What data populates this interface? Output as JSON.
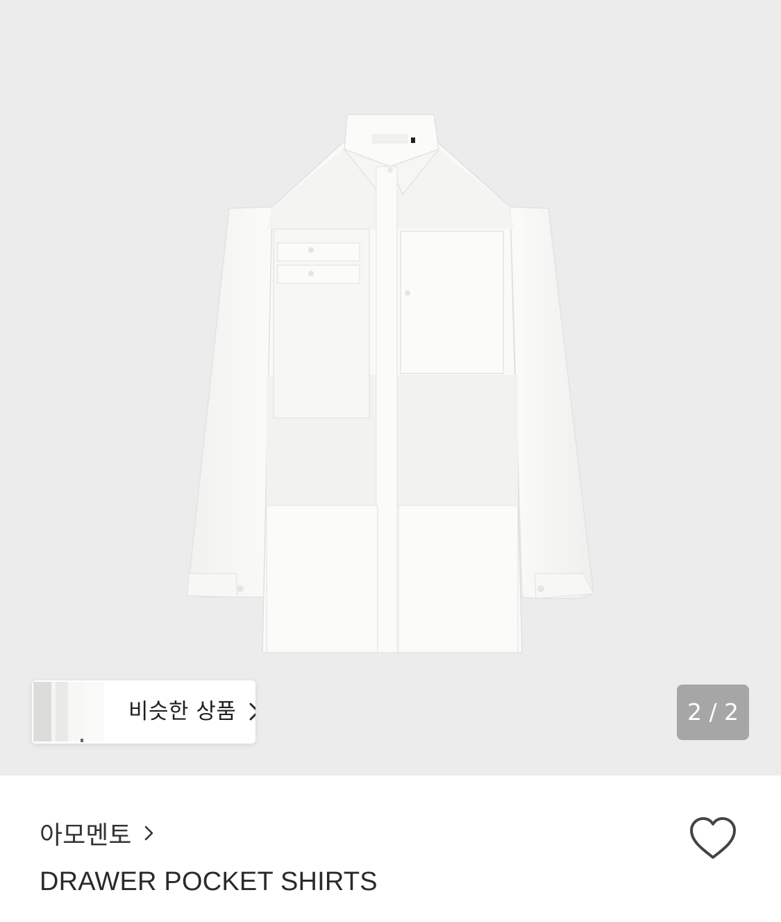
{
  "gallery": {
    "image_alt": "white shirt",
    "counter": "2 / 2",
    "similar_label": "비슷한 상품",
    "background": "#ececed"
  },
  "product": {
    "brand": "아모멘토",
    "title": "DRAWER POCKET SHIRTS"
  },
  "icons": {
    "similar_chevron": "chevron-right-icon",
    "brand_chevron": "chevron-right-icon",
    "wishlist": "heart-outline-icon"
  },
  "colors": {
    "text_primary": "#2a2a2a",
    "counter_bg": "#a6a6a6",
    "heart_stroke": "#444444"
  }
}
